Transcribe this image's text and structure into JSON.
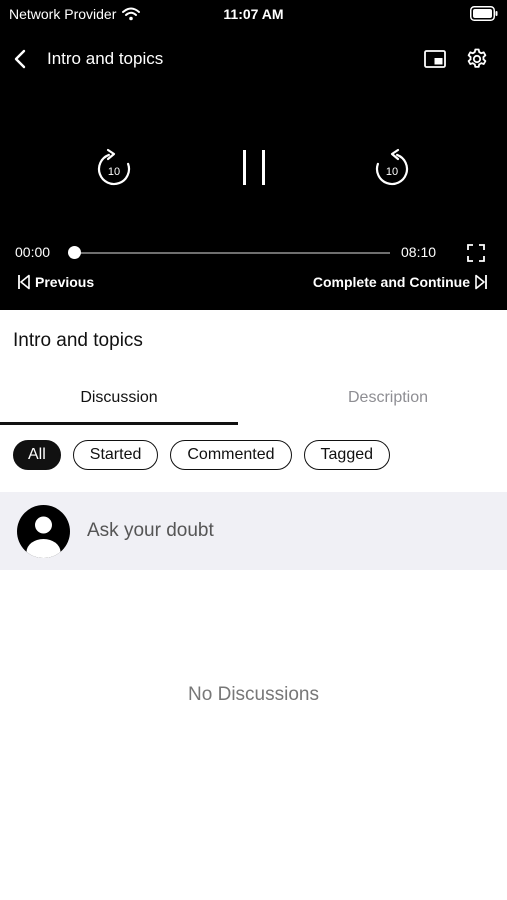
{
  "status_bar": {
    "carrier": "Network Provider",
    "time": "11:07 AM"
  },
  "header": {
    "title": "Intro and topics",
    "icons": [
      "back-chevron-icon",
      "picture-in-picture-icon",
      "gear-icon"
    ]
  },
  "player": {
    "rewind_seconds": "10",
    "forward_seconds": "10",
    "current_time": "00:00",
    "total_time": "08:10",
    "progress": 0,
    "previous_label": "Previous",
    "next_label": "Complete and Continue",
    "icons": [
      "rewind-10-icon",
      "pause-icon",
      "forward-10-icon",
      "fullscreen-icon",
      "skip-previous-icon",
      "skip-next-icon"
    ]
  },
  "lesson": {
    "title": "Intro and topics"
  },
  "tabs": [
    {
      "label": "Discussion",
      "selected": true
    },
    {
      "label": "Description",
      "selected": false
    }
  ],
  "filters": [
    {
      "label": "All",
      "selected": true
    },
    {
      "label": "Started",
      "selected": false
    },
    {
      "label": "Commented",
      "selected": false
    },
    {
      "label": "Tagged",
      "selected": false
    }
  ],
  "ask": {
    "placeholder": "Ask your doubt",
    "icon": "user-avatar-icon"
  },
  "empty_state": "No Discussions",
  "colors": {
    "player_bg": "#000000",
    "accent": "#111111",
    "inactive_tab": "#8e8e93",
    "ask_bg": "#f0f0f5"
  }
}
